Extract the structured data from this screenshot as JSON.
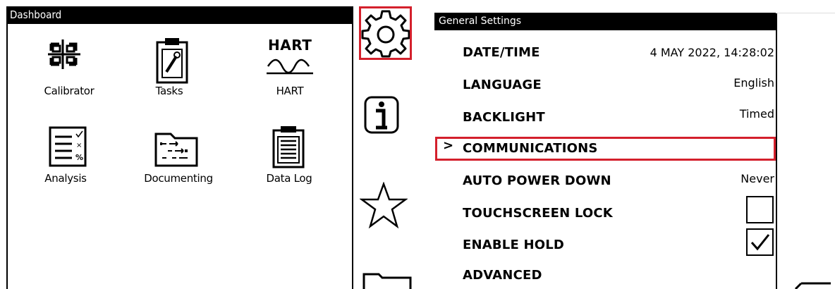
{
  "dashboard": {
    "title": "Dashboard",
    "apps": [
      {
        "label": "Calibrator",
        "icon": "crosshair-icon"
      },
      {
        "label": "Tasks",
        "icon": "wrench-clipboard-icon"
      },
      {
        "label": "HART",
        "icon": "hart-wave-icon",
        "icon_text": "HART"
      },
      {
        "label": "Analysis",
        "icon": "checklist-icon"
      },
      {
        "label": "Documenting",
        "icon": "folder-flow-icon"
      },
      {
        "label": "Data Log",
        "icon": "clipboard-list-icon"
      }
    ]
  },
  "rail": {
    "items": [
      "gear-icon",
      "info-icon",
      "star-icon",
      "folder-icon"
    ],
    "highlight_color": "#d4202c"
  },
  "settings": {
    "title": "General Settings",
    "rows": [
      {
        "label": "DATE/TIME",
        "value": "4 MAY 2022, 14:28:02"
      },
      {
        "label": "LANGUAGE",
        "value": "English"
      },
      {
        "label": "BACKLIGHT",
        "value": "Timed"
      },
      {
        "label": "COMMUNICATIONS",
        "value": ""
      },
      {
        "label": "AUTO POWER DOWN",
        "value": "Never"
      },
      {
        "label": "TOUCHSCREEN LOCK",
        "checked": false
      },
      {
        "label": "ENABLE HOLD",
        "checked": true
      },
      {
        "label": "ADVANCED",
        "value": ""
      }
    ],
    "selected_chevron": ">"
  }
}
